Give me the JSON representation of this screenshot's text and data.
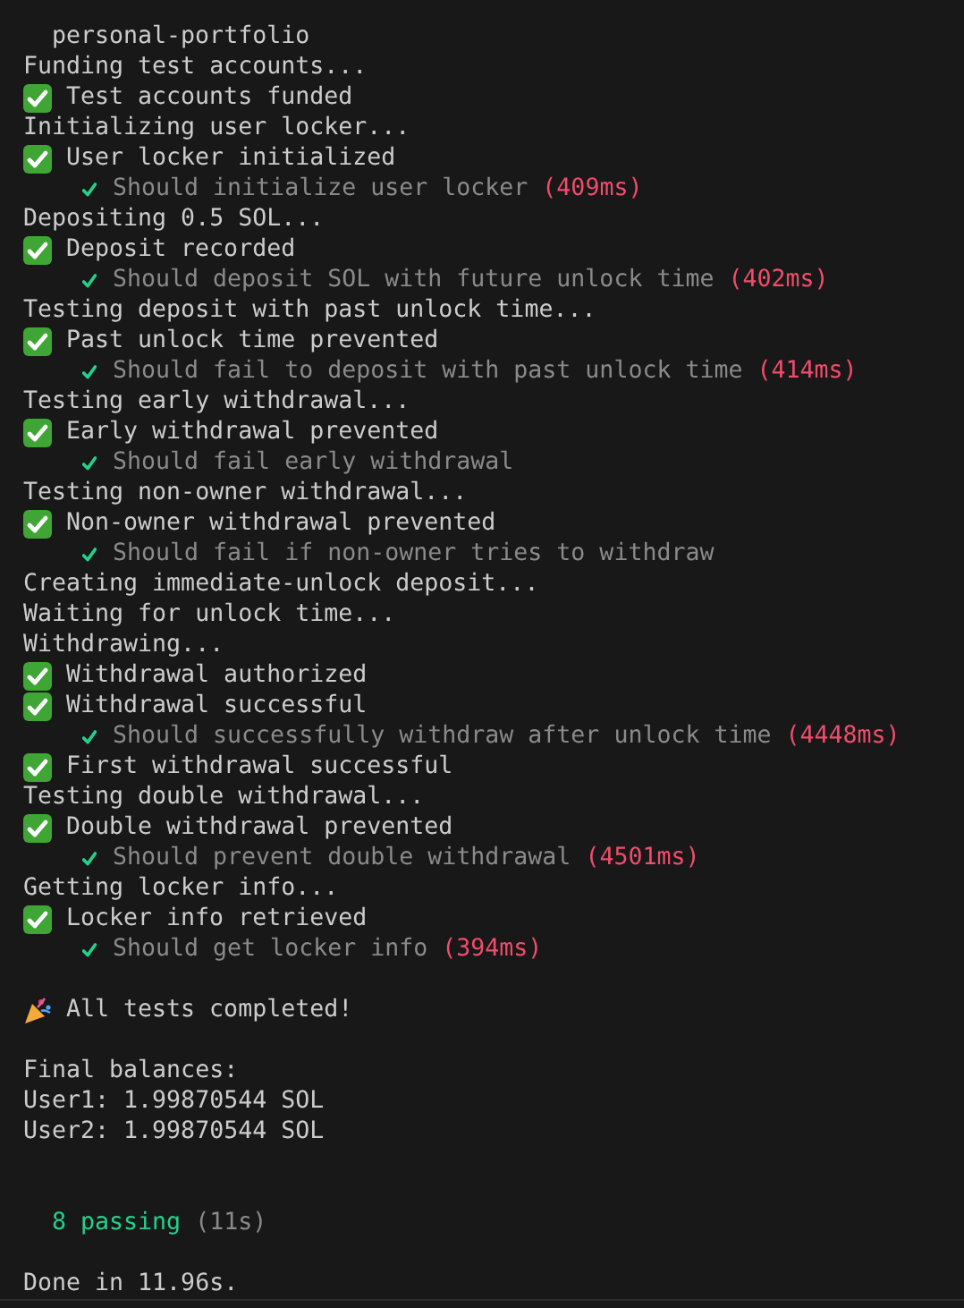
{
  "terminal": {
    "lines": [
      {
        "kind": "title",
        "text": "personal-portfolio"
      },
      {
        "kind": "plain",
        "text": "Funding test accounts..."
      },
      {
        "kind": "check",
        "text": "Test accounts funded"
      },
      {
        "kind": "plain",
        "text": "Initializing user locker..."
      },
      {
        "kind": "check",
        "text": "User locker initialized"
      },
      {
        "kind": "pass",
        "text": "Should initialize user locker",
        "duration": "(409ms)"
      },
      {
        "kind": "plain",
        "text": "Depositing 0.5 SOL..."
      },
      {
        "kind": "check",
        "text": "Deposit recorded"
      },
      {
        "kind": "pass",
        "text": "Should deposit SOL with future unlock time",
        "duration": "(402ms)"
      },
      {
        "kind": "plain",
        "text": "Testing deposit with past unlock time..."
      },
      {
        "kind": "check",
        "text": "Past unlock time prevented"
      },
      {
        "kind": "pass",
        "text": "Should fail to deposit with past unlock time",
        "duration": "(414ms)"
      },
      {
        "kind": "plain",
        "text": "Testing early withdrawal..."
      },
      {
        "kind": "check",
        "text": "Early withdrawal prevented"
      },
      {
        "kind": "pass",
        "text": "Should fail early withdrawal"
      },
      {
        "kind": "plain",
        "text": "Testing non-owner withdrawal..."
      },
      {
        "kind": "check",
        "text": "Non-owner withdrawal prevented"
      },
      {
        "kind": "pass",
        "text": "Should fail if non-owner tries to withdraw"
      },
      {
        "kind": "plain",
        "text": "Creating immediate-unlock deposit..."
      },
      {
        "kind": "plain",
        "text": "Waiting for unlock time..."
      },
      {
        "kind": "plain",
        "text": "Withdrawing..."
      },
      {
        "kind": "check",
        "text": "Withdrawal authorized"
      },
      {
        "kind": "check",
        "text": "Withdrawal successful"
      },
      {
        "kind": "pass",
        "text": "Should successfully withdraw after unlock time",
        "duration": "(4448ms)"
      },
      {
        "kind": "check",
        "text": "First withdrawal successful"
      },
      {
        "kind": "plain",
        "text": "Testing double withdrawal..."
      },
      {
        "kind": "check",
        "text": "Double withdrawal prevented"
      },
      {
        "kind": "pass",
        "text": "Should prevent double withdrawal",
        "duration": "(4501ms)"
      },
      {
        "kind": "plain",
        "text": "Getting locker info..."
      },
      {
        "kind": "check",
        "text": "Locker info retrieved"
      },
      {
        "kind": "pass",
        "text": "Should get locker info",
        "duration": "(394ms)"
      },
      {
        "kind": "blank"
      },
      {
        "kind": "party",
        "text": "All tests completed!"
      },
      {
        "kind": "blank"
      },
      {
        "kind": "plain",
        "text": "Final balances:"
      },
      {
        "kind": "plain",
        "text": "User1: 1.99870544 SOL"
      },
      {
        "kind": "plain",
        "text": "User2: 1.99870544 SOL"
      },
      {
        "kind": "blank"
      },
      {
        "kind": "blank"
      },
      {
        "kind": "summary",
        "text": "8 passing",
        "duration": "(11s)"
      },
      {
        "kind": "blank"
      },
      {
        "kind": "plain",
        "text": "Done in 11.96s."
      }
    ]
  }
}
